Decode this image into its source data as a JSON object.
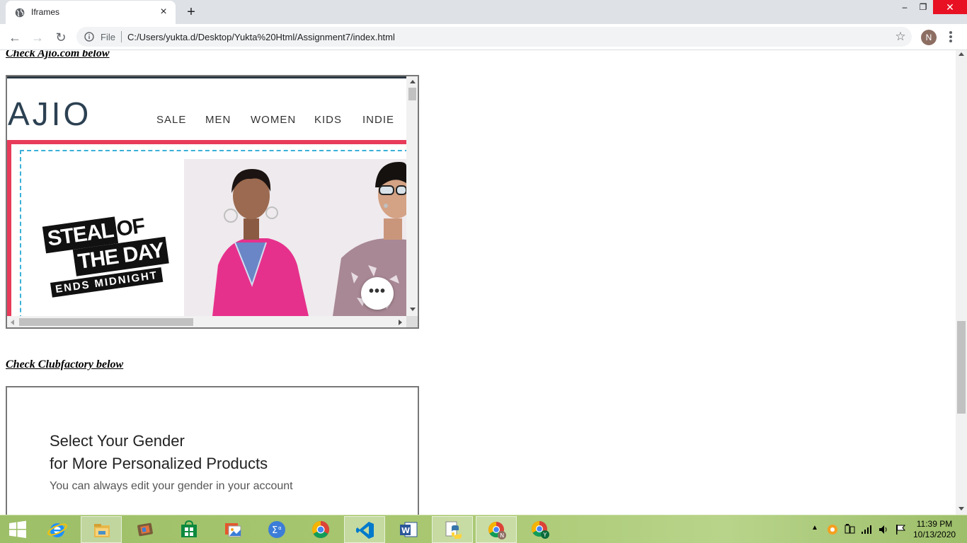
{
  "browser": {
    "tab_title": "Iframes",
    "tab_close": "×",
    "new_tab": "+",
    "window_minimize": "–",
    "window_restore": "❐",
    "window_close": "✕",
    "back": "←",
    "forward": "→",
    "reload": "↻",
    "file_label": "File",
    "url": "C:/Users/yukta.d/Desktop/Yukta%20Html/Assignment7/index.html",
    "bookmark_star": "☆",
    "profile_initial": "N"
  },
  "page": {
    "heading_ajio": "Check Ajio.com below",
    "heading_clubfactory": "Check Clubfactory below"
  },
  "ajio_frame": {
    "logo": "AJIO",
    "nav": [
      "SALE",
      "MEN",
      "WOMEN",
      "KIDS",
      "INDIE"
    ],
    "banner_line1_a": "STEAL",
    "banner_line1_b": "OF",
    "banner_line2": "THE DAY",
    "banner_line3": "ENDS MIDNIGHT",
    "more_button": "•••"
  },
  "clubfactory_frame": {
    "title_line1": "Select Your Gender",
    "title_line2": "for More Personalized Products",
    "subtitle": "You can always edit your gender in your account"
  },
  "taskbar": {
    "clock_time": "11:39 PM",
    "clock_date": "10/13/2020",
    "pinned": [
      "start",
      "internet-explorer",
      "file-explorer",
      "media-player",
      "store",
      "office-picture",
      "calculator",
      "chrome",
      "vscode",
      "word",
      "python",
      "chrome-profile-n",
      "chrome-profile-y"
    ],
    "chrome_badge_n": "N",
    "chrome_badge_y": "Y"
  },
  "colors": {
    "ajio_brand": "#2c4152",
    "ajio_pink": "#e83b5a",
    "ajio_dashed": "#3bb0d9",
    "saree_pink": "#e6318c",
    "taskbar_green": "#a8c770",
    "close_red": "#e81123"
  }
}
